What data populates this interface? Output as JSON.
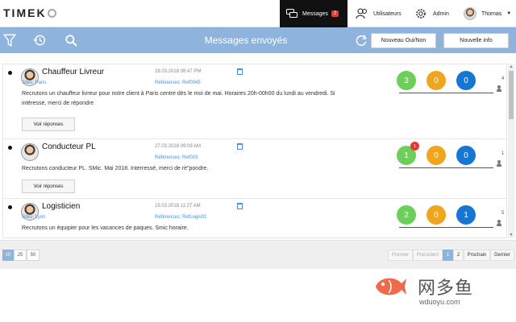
{
  "app": {
    "logo": "TIMEK"
  },
  "nav": {
    "messages": "Messages",
    "messages_badge": "2",
    "users": "Utilisateurs",
    "admin": "Admin",
    "user_name": "Thomas"
  },
  "toolbar": {
    "title": "Messages envoyés",
    "btn_new_yesno": "Nouveau Oui/Non",
    "btn_new_info": "Nouvelle info"
  },
  "messages": [
    {
      "title": "Chauffeur Livreur",
      "date": "28.03.2018 08:47 PM",
      "sites": "Sites: Paris",
      "refs": "Références: Ref0045",
      "desc": "Recrutons un chauffeur livreur pour notre client à Paris centre dès le moi de mai. Horaires 20h-00h00 du lundi au vendredi. Si intéressé, merci de répondre",
      "btn": "Voir réponses",
      "yes": "3",
      "maybe": "0",
      "no": "0",
      "count": "4"
    },
    {
      "title": "Conducteur PL",
      "date": "27.03.2018 09:09 AM",
      "sites": "Sites: Paris",
      "refs": "Références: Ref003",
      "desc": "Recrutons conducteur PL. SMic. Mai 2018. Interressé, merci de rè\"pondre.",
      "btn": "Voir réponses",
      "yes": "1",
      "maybe": "0",
      "no": "0",
      "badge": "1",
      "count": "1"
    },
    {
      "title": "Logisticien",
      "date": "15.03.2018 11:27 AM",
      "sites": "Sites: Lyon",
      "refs": "Références: RefLogis01",
      "desc": "Recrutons un équipier pour les vacances de paques. Smic horaire.",
      "yes": "2",
      "maybe": "0",
      "no": "1",
      "count": "5"
    }
  ],
  "pagination": {
    "sizes": [
      "10",
      "25",
      "50"
    ],
    "first": "Premier",
    "prev": "Précédent",
    "pages": [
      "1",
      "2"
    ],
    "next": "Prochain",
    "last": "Dernier"
  },
  "watermark": {
    "cn": "网多鱼",
    "url": "wduoyu.com"
  },
  "colors": {
    "toolbar": "#8eb4dd",
    "green": "#6ccf5a",
    "orange": "#f0a51e",
    "blue": "#1677d2",
    "badge": "#e53935"
  }
}
